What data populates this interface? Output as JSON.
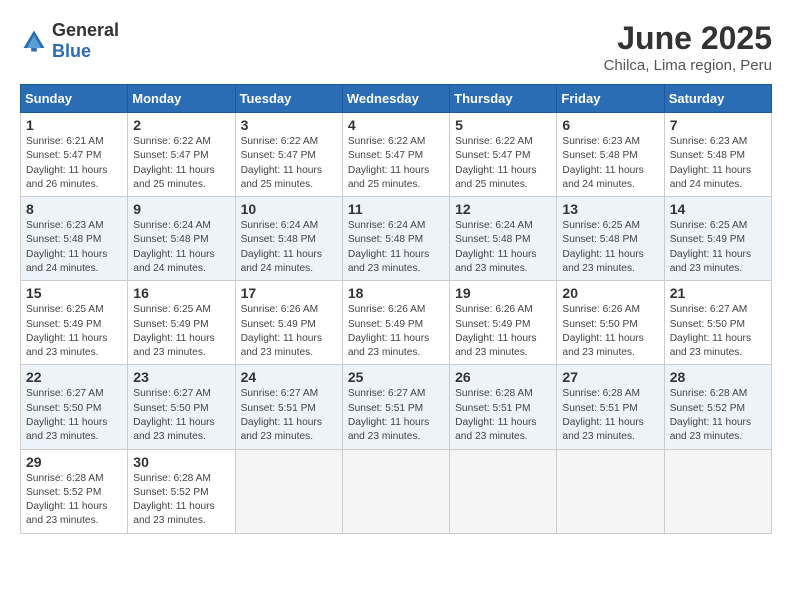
{
  "logo": {
    "text_general": "General",
    "text_blue": "Blue"
  },
  "title": "June 2025",
  "subtitle": "Chilca, Lima region, Peru",
  "days_of_week": [
    "Sunday",
    "Monday",
    "Tuesday",
    "Wednesday",
    "Thursday",
    "Friday",
    "Saturday"
  ],
  "weeks": [
    [
      {
        "day": "1",
        "sunrise": "6:21 AM",
        "sunset": "5:47 PM",
        "daylight": "11 hours and 26 minutes."
      },
      {
        "day": "2",
        "sunrise": "6:22 AM",
        "sunset": "5:47 PM",
        "daylight": "11 hours and 25 minutes."
      },
      {
        "day": "3",
        "sunrise": "6:22 AM",
        "sunset": "5:47 PM",
        "daylight": "11 hours and 25 minutes."
      },
      {
        "day": "4",
        "sunrise": "6:22 AM",
        "sunset": "5:47 PM",
        "daylight": "11 hours and 25 minutes."
      },
      {
        "day": "5",
        "sunrise": "6:22 AM",
        "sunset": "5:47 PM",
        "daylight": "11 hours and 25 minutes."
      },
      {
        "day": "6",
        "sunrise": "6:23 AM",
        "sunset": "5:48 PM",
        "daylight": "11 hours and 24 minutes."
      },
      {
        "day": "7",
        "sunrise": "6:23 AM",
        "sunset": "5:48 PM",
        "daylight": "11 hours and 24 minutes."
      }
    ],
    [
      {
        "day": "8",
        "sunrise": "6:23 AM",
        "sunset": "5:48 PM",
        "daylight": "11 hours and 24 minutes."
      },
      {
        "day": "9",
        "sunrise": "6:24 AM",
        "sunset": "5:48 PM",
        "daylight": "11 hours and 24 minutes."
      },
      {
        "day": "10",
        "sunrise": "6:24 AM",
        "sunset": "5:48 PM",
        "daylight": "11 hours and 24 minutes."
      },
      {
        "day": "11",
        "sunrise": "6:24 AM",
        "sunset": "5:48 PM",
        "daylight": "11 hours and 23 minutes."
      },
      {
        "day": "12",
        "sunrise": "6:24 AM",
        "sunset": "5:48 PM",
        "daylight": "11 hours and 23 minutes."
      },
      {
        "day": "13",
        "sunrise": "6:25 AM",
        "sunset": "5:48 PM",
        "daylight": "11 hours and 23 minutes."
      },
      {
        "day": "14",
        "sunrise": "6:25 AM",
        "sunset": "5:49 PM",
        "daylight": "11 hours and 23 minutes."
      }
    ],
    [
      {
        "day": "15",
        "sunrise": "6:25 AM",
        "sunset": "5:49 PM",
        "daylight": "11 hours and 23 minutes."
      },
      {
        "day": "16",
        "sunrise": "6:25 AM",
        "sunset": "5:49 PM",
        "daylight": "11 hours and 23 minutes."
      },
      {
        "day": "17",
        "sunrise": "6:26 AM",
        "sunset": "5:49 PM",
        "daylight": "11 hours and 23 minutes."
      },
      {
        "day": "18",
        "sunrise": "6:26 AM",
        "sunset": "5:49 PM",
        "daylight": "11 hours and 23 minutes."
      },
      {
        "day": "19",
        "sunrise": "6:26 AM",
        "sunset": "5:49 PM",
        "daylight": "11 hours and 23 minutes."
      },
      {
        "day": "20",
        "sunrise": "6:26 AM",
        "sunset": "5:50 PM",
        "daylight": "11 hours and 23 minutes."
      },
      {
        "day": "21",
        "sunrise": "6:27 AM",
        "sunset": "5:50 PM",
        "daylight": "11 hours and 23 minutes."
      }
    ],
    [
      {
        "day": "22",
        "sunrise": "6:27 AM",
        "sunset": "5:50 PM",
        "daylight": "11 hours and 23 minutes."
      },
      {
        "day": "23",
        "sunrise": "6:27 AM",
        "sunset": "5:50 PM",
        "daylight": "11 hours and 23 minutes."
      },
      {
        "day": "24",
        "sunrise": "6:27 AM",
        "sunset": "5:51 PM",
        "daylight": "11 hours and 23 minutes."
      },
      {
        "day": "25",
        "sunrise": "6:27 AM",
        "sunset": "5:51 PM",
        "daylight": "11 hours and 23 minutes."
      },
      {
        "day": "26",
        "sunrise": "6:28 AM",
        "sunset": "5:51 PM",
        "daylight": "11 hours and 23 minutes."
      },
      {
        "day": "27",
        "sunrise": "6:28 AM",
        "sunset": "5:51 PM",
        "daylight": "11 hours and 23 minutes."
      },
      {
        "day": "28",
        "sunrise": "6:28 AM",
        "sunset": "5:52 PM",
        "daylight": "11 hours and 23 minutes."
      }
    ],
    [
      {
        "day": "29",
        "sunrise": "6:28 AM",
        "sunset": "5:52 PM",
        "daylight": "11 hours and 23 minutes."
      },
      {
        "day": "30",
        "sunrise": "6:28 AM",
        "sunset": "5:52 PM",
        "daylight": "11 hours and 23 minutes."
      },
      null,
      null,
      null,
      null,
      null
    ]
  ]
}
